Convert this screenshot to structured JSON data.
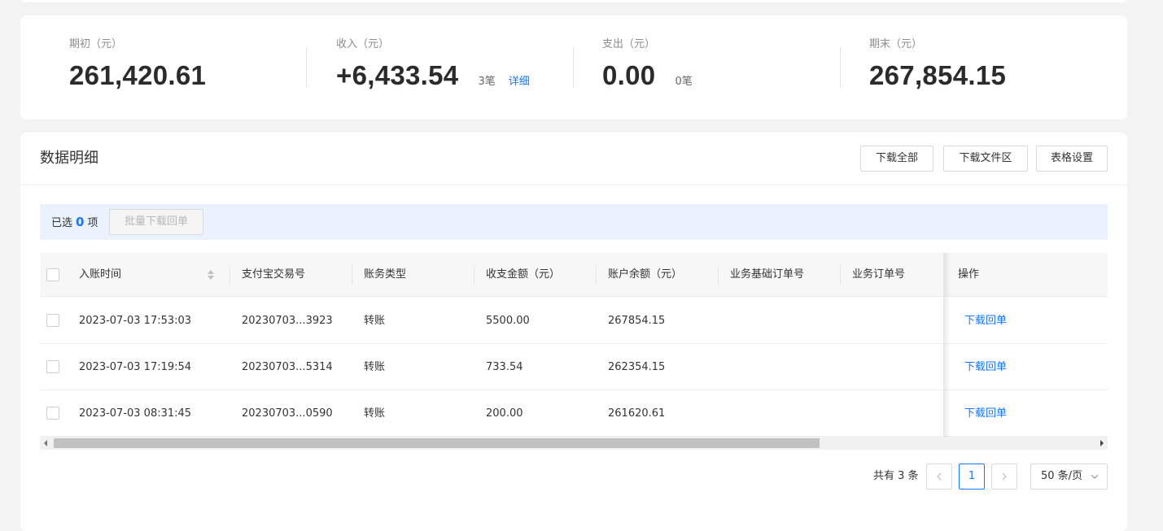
{
  "summary": {
    "opening": {
      "label": "期初（元）",
      "value": "261,420.61"
    },
    "income": {
      "label": "收入（元）",
      "value": "+6,433.54",
      "count": "3笔",
      "detail_link": "详细"
    },
    "expense": {
      "label": "支出（元）",
      "value": "0.00",
      "count": "0笔"
    },
    "closing": {
      "label": "期末（元）",
      "value": "267,854.15"
    }
  },
  "detail": {
    "title": "数据明细",
    "buttons": {
      "download_all": "下载全部",
      "download_area": "下载文件区",
      "table_settings": "表格设置"
    },
    "selection": {
      "prefix": "已选",
      "count": "0",
      "suffix": "项",
      "batch_button": "批量下载回单"
    }
  },
  "table": {
    "columns": [
      "入账时间",
      "支付宝交易号",
      "账务类型",
      "收支金额（元）",
      "账户余额（元）",
      "业务基础订单号",
      "业务订单号",
      "操作"
    ],
    "rows": [
      {
        "time": "2023-07-03 17:53:03",
        "trade_no": "20230703...3923",
        "type": "转账",
        "amount": "5500.00",
        "balance": "267854.15",
        "base_order": "",
        "order": "",
        "action": "下载回单"
      },
      {
        "time": "2023-07-03 17:19:54",
        "trade_no": "20230703...5314",
        "type": "转账",
        "amount": "733.54",
        "balance": "262354.15",
        "base_order": "",
        "order": "",
        "action": "下载回单"
      },
      {
        "time": "2023-07-03 08:31:45",
        "trade_no": "20230703...0590",
        "type": "转账",
        "amount": "200.00",
        "balance": "261620.61",
        "base_order": "",
        "order": "",
        "action": "下载回单"
      }
    ]
  },
  "pagination": {
    "total": "共有 3 条",
    "current_page": "1",
    "page_size": "50 条/页"
  },
  "colors": {
    "accent": "#1677ff",
    "select_bar_bg": "#eaf2fd",
    "header_bg": "#f7f7f7"
  }
}
